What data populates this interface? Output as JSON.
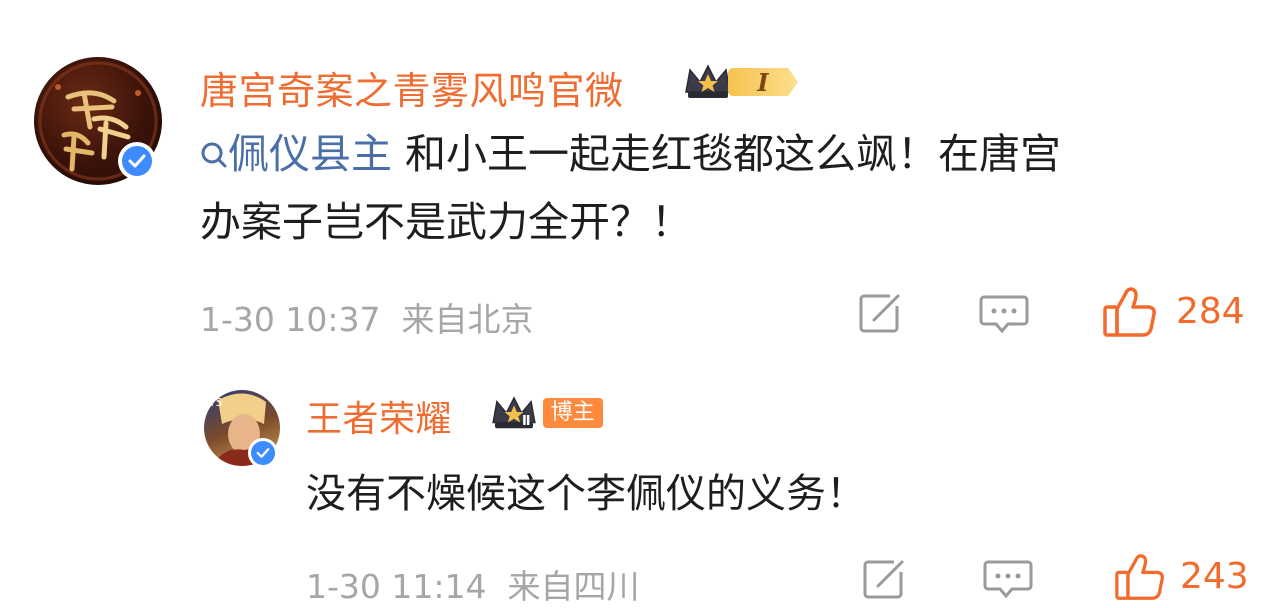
{
  "comment1": {
    "avatar_icon": "tang-palace-logo-icon",
    "username": "唐宫奇案之青雾风鸣官微",
    "level_badge": "I",
    "topic": "佩仪县主",
    "text_line1": "和小王一起走红毯都这么飒！在唐宫",
    "text_line2": "办案子岂不是武力全开？！",
    "timestamp": "1-30 10:37",
    "location": "来自北京",
    "like_count": "284"
  },
  "comment2": {
    "avatar_icon": "hero-portrait-icon",
    "username": "王者荣耀",
    "level_badge": "Ⅱ",
    "role_tag": "博主",
    "text": "没有不燥候这个李佩仪的义务！",
    "timestamp": "1-30 11:14",
    "location": "来自四川",
    "like_count": "243"
  },
  "colors": {
    "accent": "#f06d32",
    "topic": "#4a6ea8",
    "verified": "#3d8bff",
    "meta": "#a6a6a6"
  }
}
